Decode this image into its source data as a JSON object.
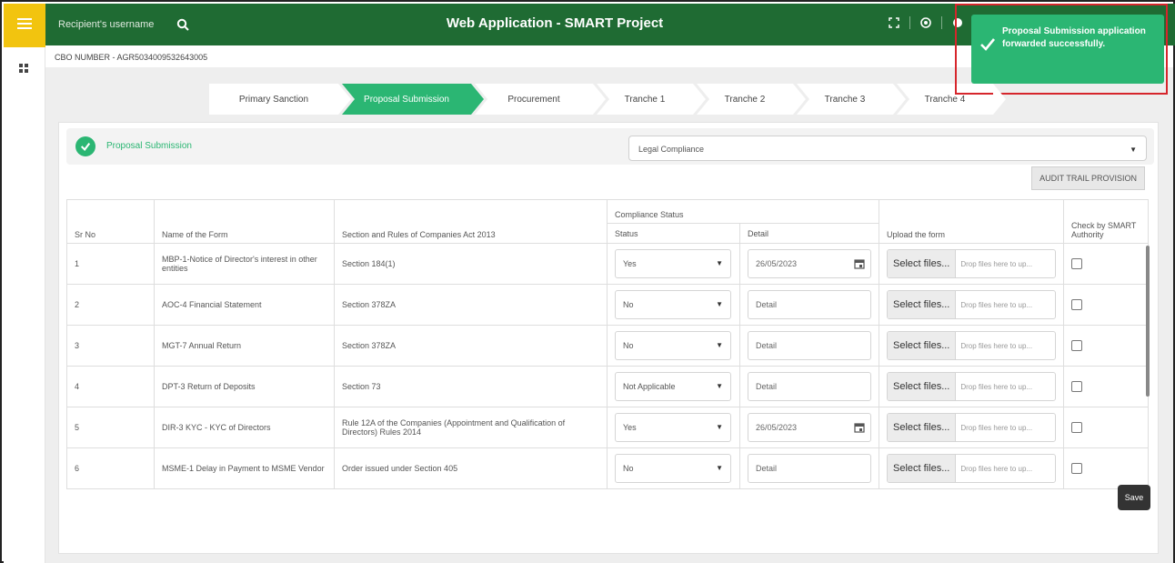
{
  "app": {
    "title": "Web Application - SMART Project"
  },
  "search": {
    "placeholder": "Recipient's username"
  },
  "cbo": {
    "label": "CBO NUMBER - AGR5034009532643005"
  },
  "steps": [
    {
      "label": "Primary Sanction",
      "state": "done"
    },
    {
      "label": "Proposal Submission",
      "state": "active"
    },
    {
      "label": "Procurement",
      "state": "pending"
    },
    {
      "label": "Tranche 1",
      "state": "pending"
    },
    {
      "label": "Tranche 2",
      "state": "pending"
    },
    {
      "label": "Tranche 3",
      "state": "pending"
    },
    {
      "label": "Tranche 4",
      "state": "pending"
    }
  ],
  "section": {
    "title": "Proposal Submission",
    "select_value": "Legal Compliance",
    "audit_label": "AUDIT TRAIL PROVISION"
  },
  "table": {
    "headers": {
      "sno": "Sr No",
      "form": "Name of the Form",
      "section": "Section and Rules of Companies Act 2013",
      "compliance": "Compliance Status",
      "status": "Status",
      "detail": "Detail",
      "upload": "Upload the form",
      "check": "Check by SMART Authority"
    },
    "rows": [
      {
        "sno": "1",
        "form": "MBP-1-Notice of Director's interest in other entities",
        "section": "Section 184(1)",
        "status": "Yes",
        "detail": "26/05/2023",
        "has_date": true
      },
      {
        "sno": "2",
        "form": "AOC-4 Financial Statement",
        "section": "Section 378ZA",
        "status": "No",
        "detail": "Detail",
        "has_date": false
      },
      {
        "sno": "3",
        "form": "MGT-7 Annual Return",
        "section": "Section 378ZA",
        "status": "No",
        "detail": "Detail",
        "has_date": false
      },
      {
        "sno": "4",
        "form": "DPT-3 Return of Deposits",
        "section": "Section 73",
        "status": "Not Applicable",
        "detail": "Detail",
        "has_date": false
      },
      {
        "sno": "5",
        "form": "DIR-3 KYC - KYC of Directors",
        "section": "Rule 12A of the Companies (Appointment and Qualification of Directors) Rules 2014",
        "status": "Yes",
        "detail": "26/05/2023",
        "has_date": true
      },
      {
        "sno": "6",
        "form": "MSME-1 Delay in Payment to MSME Vendor",
        "section": "Order issued under Section 405",
        "status": "No",
        "detail": "Detail",
        "has_date": false
      }
    ],
    "upload_button": "Select files...",
    "upload_drop": "Drop files here to up..."
  },
  "save_label": "Save",
  "toast": {
    "message": "Proposal Submission application forwarded successfully."
  },
  "colors": {
    "topbar": "#1f6b33",
    "accent": "#2bb673",
    "hamburger": "#f2c40f",
    "toast_outline": "#d6262c"
  }
}
